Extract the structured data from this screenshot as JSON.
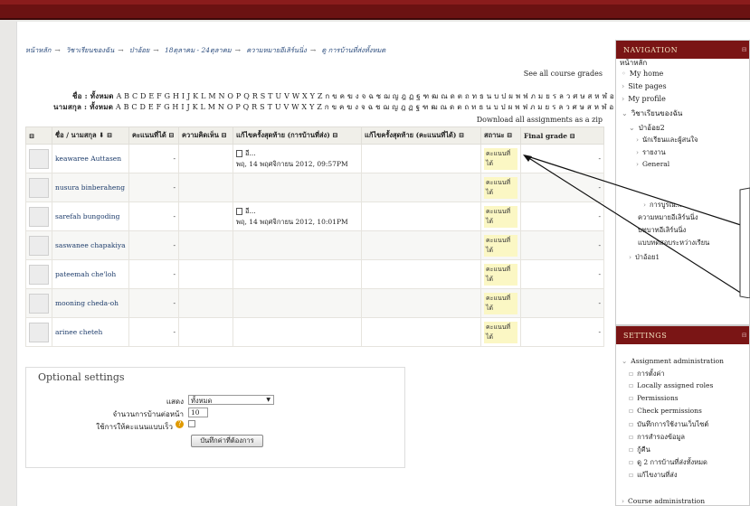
{
  "breadcrumb": [
    "หน้าหลัก",
    "วิชาเรียนของฉัน",
    "ป่าอ้อย",
    "18ตุลาคม - 24ตุลาคม",
    "ความหมายอีเลิร์นนิ่ง",
    "ดู การบ้านที่ส่งทั้งหมด"
  ],
  "links": {
    "see_grades": "See all course grades",
    "download": "Download all assignments as a zip"
  },
  "initials": {
    "first_label": "ชื่อ : ",
    "last_label": "นามสกุล : ",
    "all": "ทั้งหมด",
    "letters": "A B C D E F G H I J K L M N O P Q R S T U V W X Y Z ก ข ค ฆ ง จ ฉ ช ฌ ญ ฎ ฏ ฐ ฑ ฒ ณ ด ต ถ ท ธ น บ ป ผ พ ฟ ภ ม ย ร ล ว ศ ษ ส ห ฬ อ ฮ"
  },
  "table": {
    "headers": [
      "⊟",
      "ชื่อ / นามสกุล ⬇ ⊟",
      "คะแนนที่ได้ ⊟",
      "ความคิดเห็น ⊟",
      "แก้ไขครั้งสุดท้าย (การบ้านที่ส่ง) ⊟",
      "แก้ไขครั้งสุดท้าย (คะแนนที่ได้) ⊟",
      "สถานะ ⊟",
      "Final grade ⊟"
    ],
    "rows": [
      {
        "name": "keawaree Auttasen",
        "grade": "-",
        "file": "อี...",
        "date": "พฤ, 14 พฤศจิกายน 2012, 09:57PM",
        "status": "คะแนนที่ได้",
        "final": "-"
      },
      {
        "name": "nusura binberaheng",
        "grade": "-",
        "file": "",
        "date": "",
        "status": "คะแนนที่ได้",
        "final": "-"
      },
      {
        "name": "sarefah bungoding",
        "grade": "-",
        "file": "อี...",
        "date": "พฤ, 14 พฤศจิกายน 2012, 10:01PM",
        "status": "คะแนนที่ได้",
        "final": "-"
      },
      {
        "name": "saswanee chapakiya",
        "grade": "-",
        "file": "",
        "date": "",
        "status": "คะแนนที่ได้",
        "final": "-"
      },
      {
        "name": "pateemah che'loh",
        "grade": "-",
        "file": "",
        "date": "",
        "status": "คะแนนที่ได้",
        "final": "-"
      },
      {
        "name": "mooning cheda-oh",
        "grade": "-",
        "file": "",
        "date": "",
        "status": "คะแนนที่ได้",
        "final": "-"
      },
      {
        "name": "arinee cheteh",
        "grade": "-",
        "file": "",
        "date": "",
        "status": "คะแนนที่ได้",
        "final": "-"
      }
    ]
  },
  "optional": {
    "legend": "Optional settings",
    "show_label": "แสดง",
    "show_value": "ทั้งหมด",
    "perpage_label": "จำนวนการบ้านต่อหน้า",
    "perpage_value": "10",
    "quick_label": "ใช้การให้คะแนนแบบเร็ว",
    "save": "บันทึกค่าที่ต้องการ"
  },
  "nav": {
    "title": "NAVIGATION",
    "items": [
      "หน้าหลัก",
      "My home",
      "Site pages",
      "My profile",
      "วิชาเรียนของฉัน",
      "ป่าอ้อย2",
      "นักเรียนและผู้สนใจ",
      "รายงาน",
      "General",
      "การบูรณ...",
      "ความหมายอีเลิร์นนิ่ง",
      "บทบาทอีเลิร์นนิ่ง",
      "แบบทดสอบระหว่างเรียน",
      "ป่าอ้อย1"
    ]
  },
  "settings": {
    "title": "SETTINGS",
    "items": [
      "Assignment administration",
      "การตั้งค่า",
      "Locally assigned roles",
      "Permissions",
      "Check permissions",
      "บันทึกการใช้งานเว็บไซต์",
      "การสำรองข้อมูล",
      "กู้คืน",
      "ดู 2 การบ้านที่ส่งทั้งหมด",
      "แก้ไขงานที่ส่ง",
      "Course administration"
    ]
  }
}
